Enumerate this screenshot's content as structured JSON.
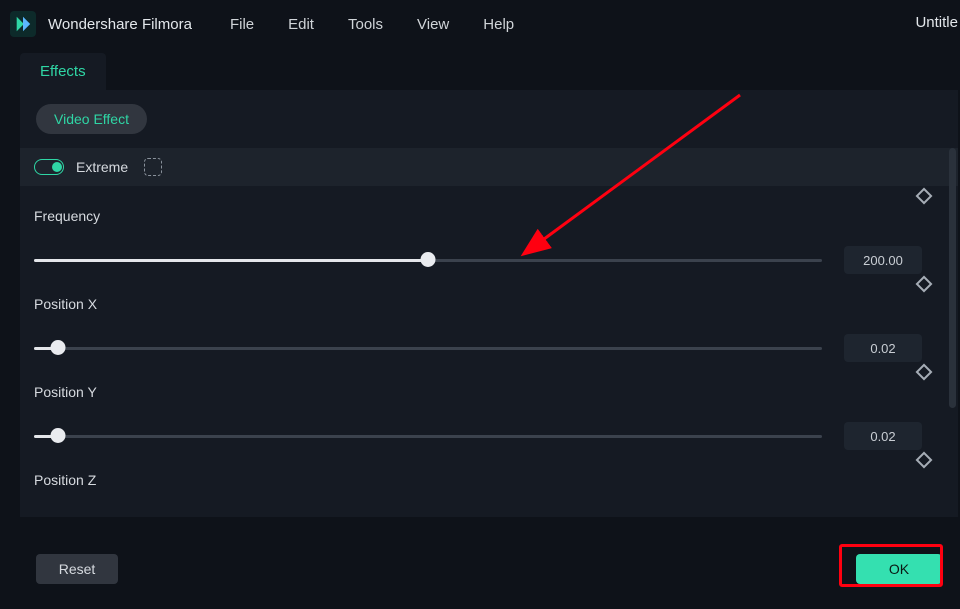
{
  "app": {
    "name": "Wondershare Filmora"
  },
  "menu": {
    "file": "File",
    "edit": "Edit",
    "tools": "Tools",
    "view": "View",
    "help": "Help"
  },
  "document": {
    "title": "Untitle"
  },
  "tabs": {
    "effects": "Effects"
  },
  "chip": {
    "video_effect": "Video Effect"
  },
  "effect": {
    "name": "Extreme",
    "enabled": true
  },
  "params": {
    "frequency": {
      "label": "Frequency",
      "value": "200.00",
      "fill_pct": 50,
      "thumb_pct": 50
    },
    "position_x": {
      "label": "Position X",
      "value": "0.02",
      "fill_pct": 3,
      "thumb_pct": 3
    },
    "position_y": {
      "label": "Position Y",
      "value": "0.02",
      "fill_pct": 3,
      "thumb_pct": 3
    },
    "position_z": {
      "label": "Position Z"
    }
  },
  "actions": {
    "reset": "Reset",
    "ok": "OK"
  },
  "colors": {
    "accent": "#2fd6a5",
    "panel": "#151a23",
    "bg": "#0e1219"
  }
}
